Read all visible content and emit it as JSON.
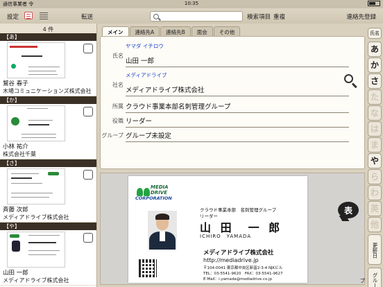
{
  "status_bar": {
    "carrier": "通信事業者 令",
    "time": "10:35",
    "battery": ""
  },
  "toolbar": {
    "settings_label": "設定",
    "forward_label": "転送",
    "search_value": "",
    "search_field_label": "検索項目",
    "duplicate_label": "重複",
    "register_label": "連絡先登録"
  },
  "list": {
    "count": "4 件",
    "sections": [
      {
        "header": "【あ】",
        "contacts": [
          {
            "name": "鷲谷 春子",
            "company": "木場コミュニケーションズ株式会社"
          }
        ]
      },
      {
        "header": "【か】",
        "contacts": [
          {
            "name": "小林 祐介",
            "company": "株式会社千葉"
          }
        ]
      },
      {
        "header": "【さ】",
        "contacts": [
          {
            "name": "斉藤 次郎",
            "company": "メディアドライブ株式会社"
          }
        ]
      },
      {
        "header": "【や】",
        "contacts": [
          {
            "name": "山田 一郎",
            "company": "メディアドライブ株式会社"
          }
        ]
      }
    ]
  },
  "tabs": [
    "メイン",
    "連絡先A",
    "連絡先B",
    "面会",
    "その他"
  ],
  "detail": {
    "name_label": "氏名",
    "name_ruby": "ヤマダ イチロウ",
    "name": "山田 一郎",
    "company_label": "社名",
    "company_ruby": "メディアドライブ",
    "company": "メディアドライブ株式会社",
    "dept_label": "所属",
    "dept": "クラウド事業本部名刺管理グループ",
    "title_label": "役職",
    "title": "リーダー",
    "group_label": "グループ",
    "group": "グループ未設定"
  },
  "card": {
    "logo_line1": "MEDIA",
    "logo_line2": "DRIVE",
    "logo_line3": "CORPORATION",
    "dept": "クラウド事業本部　名刺管理グループ",
    "role": "リーダー",
    "name": "山 田　一 郎",
    "roman": "ICHIRO　YAMADA",
    "company": "メディアドライブ株式会社",
    "url": "http://mediadrive.jp",
    "addr1": "〒104-0041 東京都中央区新富2-3-4 NJKビル",
    "addr2": "TEL：03-5541-9620　FAX：03-5541-9627",
    "addr3": "E-Mail：i.yamada@mediadrive.co.jp",
    "flip_label": "表"
  },
  "index": {
    "top_label": "氏名",
    "kana": [
      "あ",
      "か",
      "さ",
      "た",
      "な",
      "は",
      "ま",
      "や",
      "ら",
      "わ",
      "英",
      "他"
    ],
    "kana_active": [
      "あ",
      "か",
      "さ",
      "や"
    ],
    "update_label": "更新日",
    "group_label": "グループ"
  },
  "colors": {
    "section_header": "#3b3026",
    "ruby": "#1a3fd0",
    "logo_green": "#23a343"
  }
}
